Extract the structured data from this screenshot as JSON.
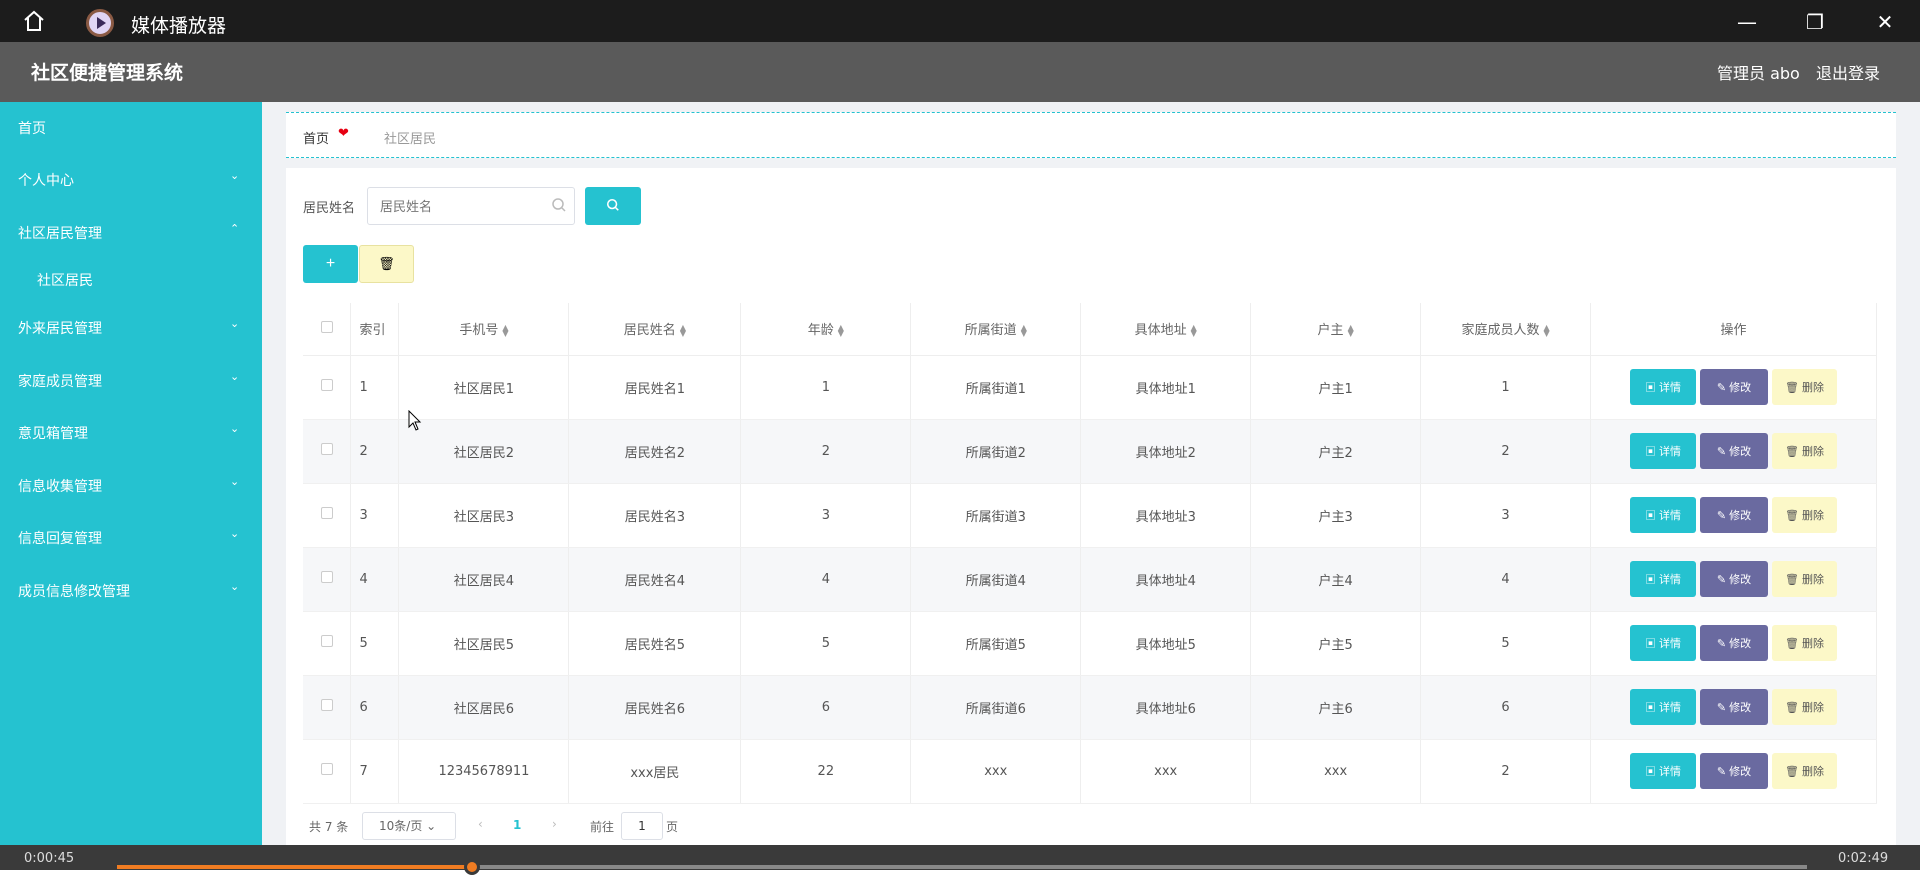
{
  "titlebar": {
    "title": "媒体播放器",
    "minimize": "—",
    "maximize": "❐",
    "close": "✕"
  },
  "header": {
    "system_title": "社区便捷管理系统",
    "admin": "管理员 abo",
    "logout": "退出登录"
  },
  "sidebar": {
    "items": [
      {
        "label": "首页",
        "chevron": ""
      },
      {
        "label": "个人中心",
        "chevron": "⌄"
      },
      {
        "label": "社区居民管理",
        "chevron": "⌃"
      },
      {
        "label": "社区居民",
        "chevron": ""
      },
      {
        "label": "外来居民管理",
        "chevron": "⌄"
      },
      {
        "label": "家庭成员管理",
        "chevron": "⌄"
      },
      {
        "label": "意见箱管理",
        "chevron": "⌄"
      },
      {
        "label": "信息收集管理",
        "chevron": "⌄"
      },
      {
        "label": "信息回复管理",
        "chevron": "⌄"
      },
      {
        "label": "成员信息修改管理",
        "chevron": "⌄"
      }
    ]
  },
  "breadcrumb": {
    "home": "首页",
    "separator": "❤",
    "current": "社区居民"
  },
  "search": {
    "label": "居民姓名",
    "placeholder": "居民姓名"
  },
  "toolbar": {
    "add_label": "+",
    "delete_label": "🗑"
  },
  "table": {
    "headers": [
      "索引",
      "手机号",
      "居民姓名",
      "年龄",
      "所属街道",
      "具体地址",
      "户主",
      "家庭成员人数",
      "操作"
    ],
    "rows": [
      [
        "1",
        "社区居民1",
        "居民姓名1",
        "1",
        "所属街道1",
        "具体地址1",
        "户主1",
        "1"
      ],
      [
        "2",
        "社区居民2",
        "居民姓名2",
        "2",
        "所属街道2",
        "具体地址2",
        "户主2",
        "2"
      ],
      [
        "3",
        "社区居民3",
        "居民姓名3",
        "3",
        "所属街道3",
        "具体地址3",
        "户主3",
        "3"
      ],
      [
        "4",
        "社区居民4",
        "居民姓名4",
        "4",
        "所属街道4",
        "具体地址4",
        "户主4",
        "4"
      ],
      [
        "5",
        "社区居民5",
        "居民姓名5",
        "5",
        "所属街道5",
        "具体地址5",
        "户主5",
        "5"
      ],
      [
        "6",
        "社区居民6",
        "居民姓名6",
        "6",
        "所属街道6",
        "具体地址6",
        "户主6",
        "6"
      ],
      [
        "7",
        "12345678911",
        "xxx居民",
        "22",
        "xxx",
        "xxx",
        "xxx",
        "2"
      ]
    ],
    "actions": {
      "detail": "▣ 详情",
      "edit": "✎ 修改",
      "delete": "🗑 删除"
    }
  },
  "pagination": {
    "total": "共 7 条",
    "page_size": "10条/页",
    "current_page": "1",
    "goto_label": "前往",
    "goto_value": "1",
    "page_unit": "页"
  },
  "player": {
    "current_time": "0:00:45",
    "total_time": "0:02:49",
    "progress": 0.21
  },
  "colors": {
    "accent": "#25c2d0",
    "edit": "#6a6aa0",
    "warn_bg": "#fcf8c8",
    "header": "#5a5a5a"
  }
}
